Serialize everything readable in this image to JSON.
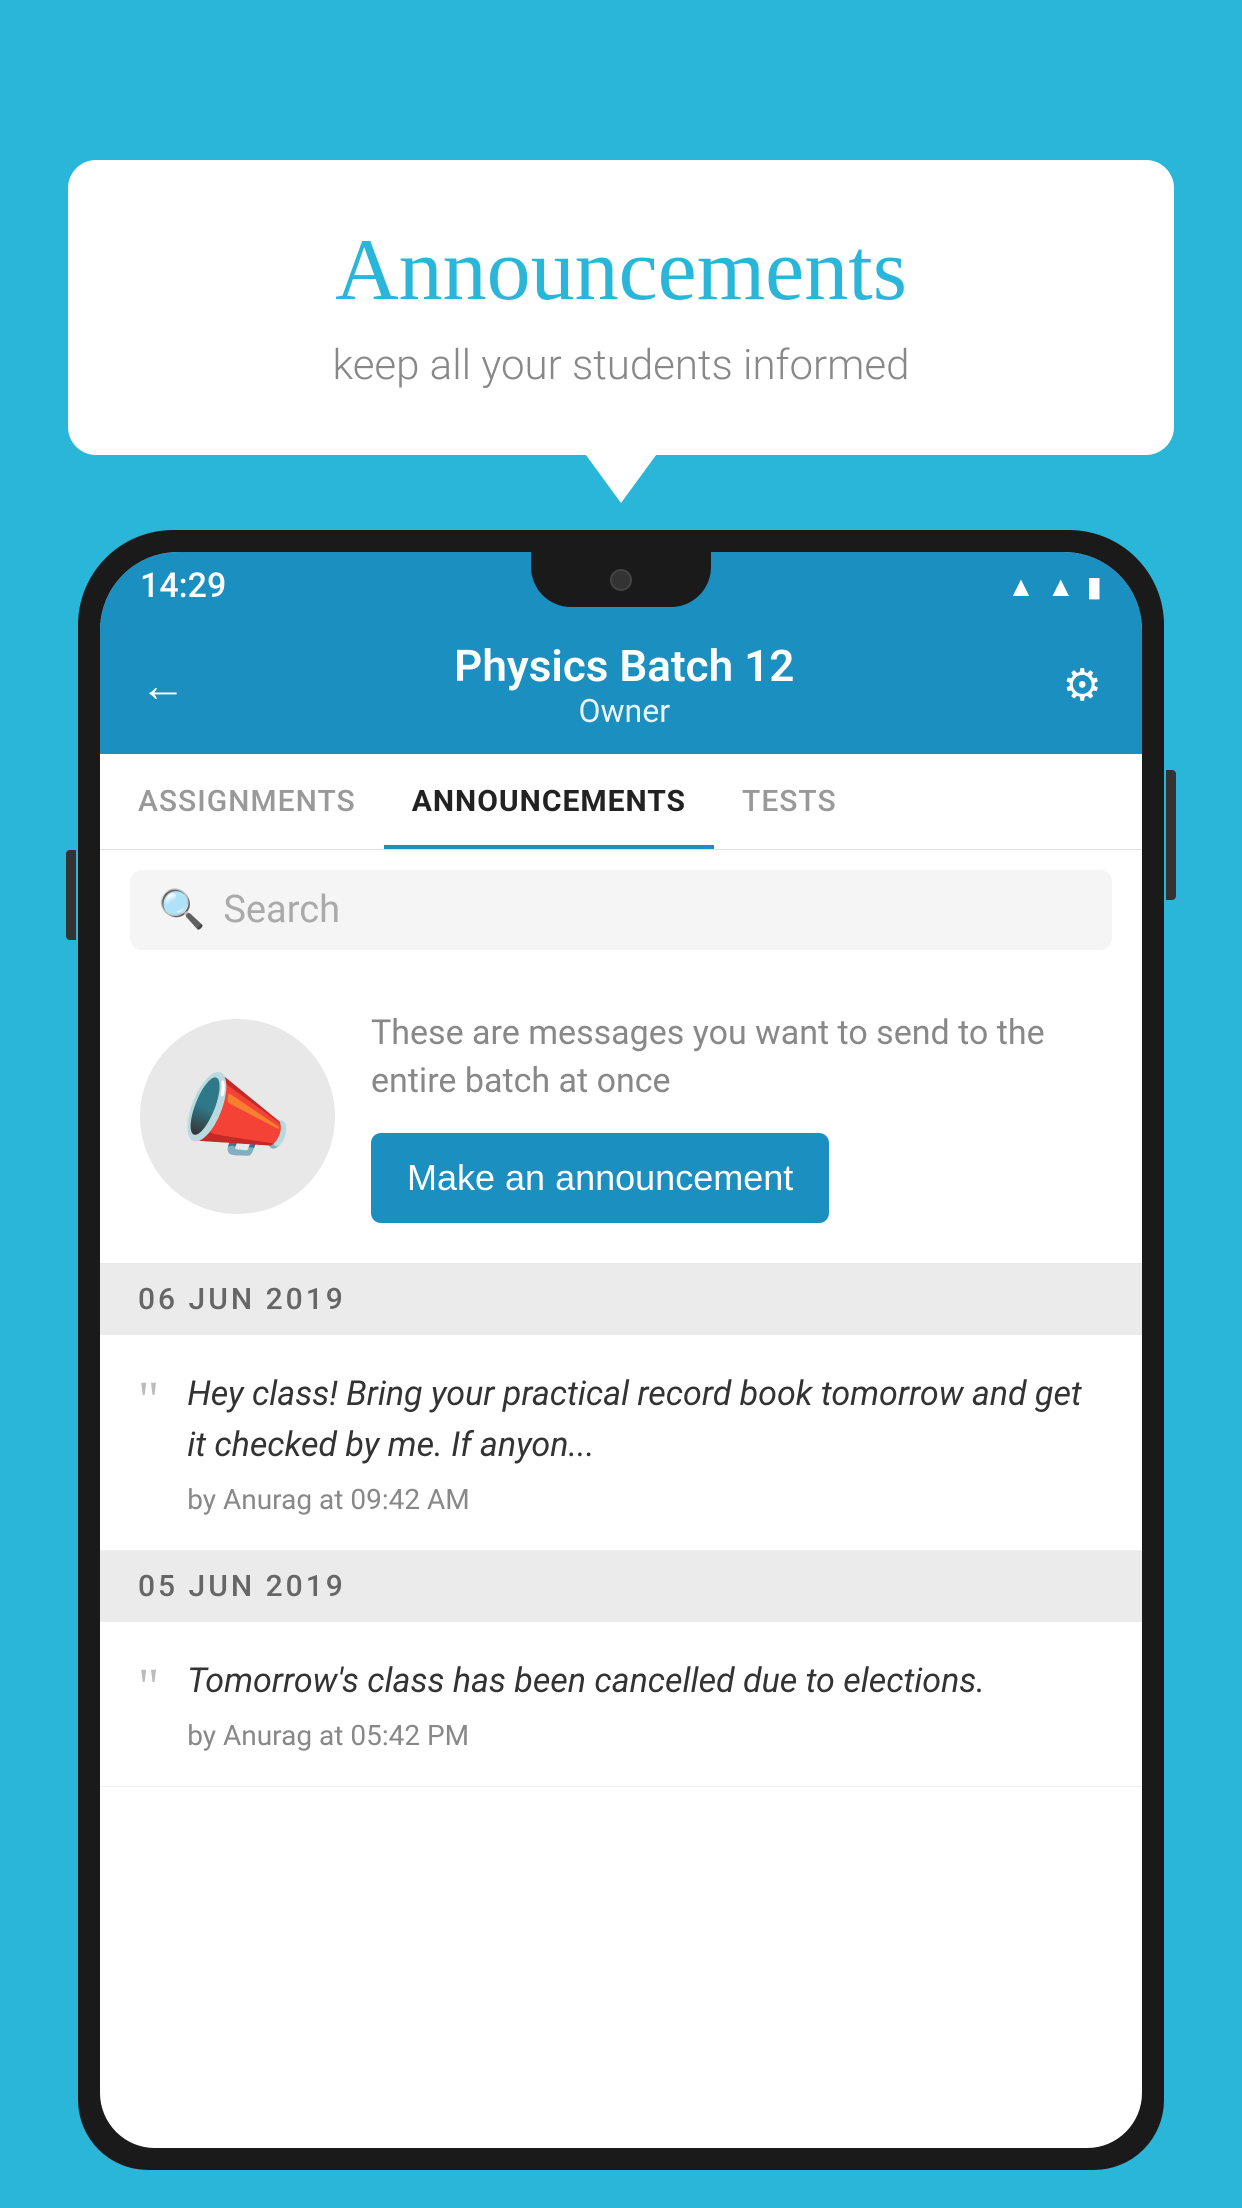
{
  "background_color": "#29b6d8",
  "speech_bubble": {
    "title": "Announcements",
    "subtitle": "keep all your students informed"
  },
  "phone": {
    "status_bar": {
      "time": "14:29"
    },
    "header": {
      "back_label": "←",
      "title": "Physics Batch 12",
      "subtitle": "Owner",
      "settings_label": "⚙"
    },
    "tabs": [
      {
        "label": "ASSIGNMENTS",
        "active": false
      },
      {
        "label": "ANNOUNCEMENTS",
        "active": true
      },
      {
        "label": "TESTS",
        "active": false
      }
    ],
    "search": {
      "placeholder": "Search"
    },
    "announcement_prompt": {
      "description": "These are messages you want to send to the entire batch at once",
      "button_label": "Make an announcement"
    },
    "announcements": [
      {
        "date": "06  JUN  2019",
        "text": "Hey class! Bring your practical record book tomorrow and get it checked by me. If anyon...",
        "meta": "by Anurag at 09:42 AM"
      },
      {
        "date": "05  JUN  2019",
        "text": "Tomorrow's class has been cancelled due to elections.",
        "meta": "by Anurag at 05:42 PM"
      }
    ]
  }
}
